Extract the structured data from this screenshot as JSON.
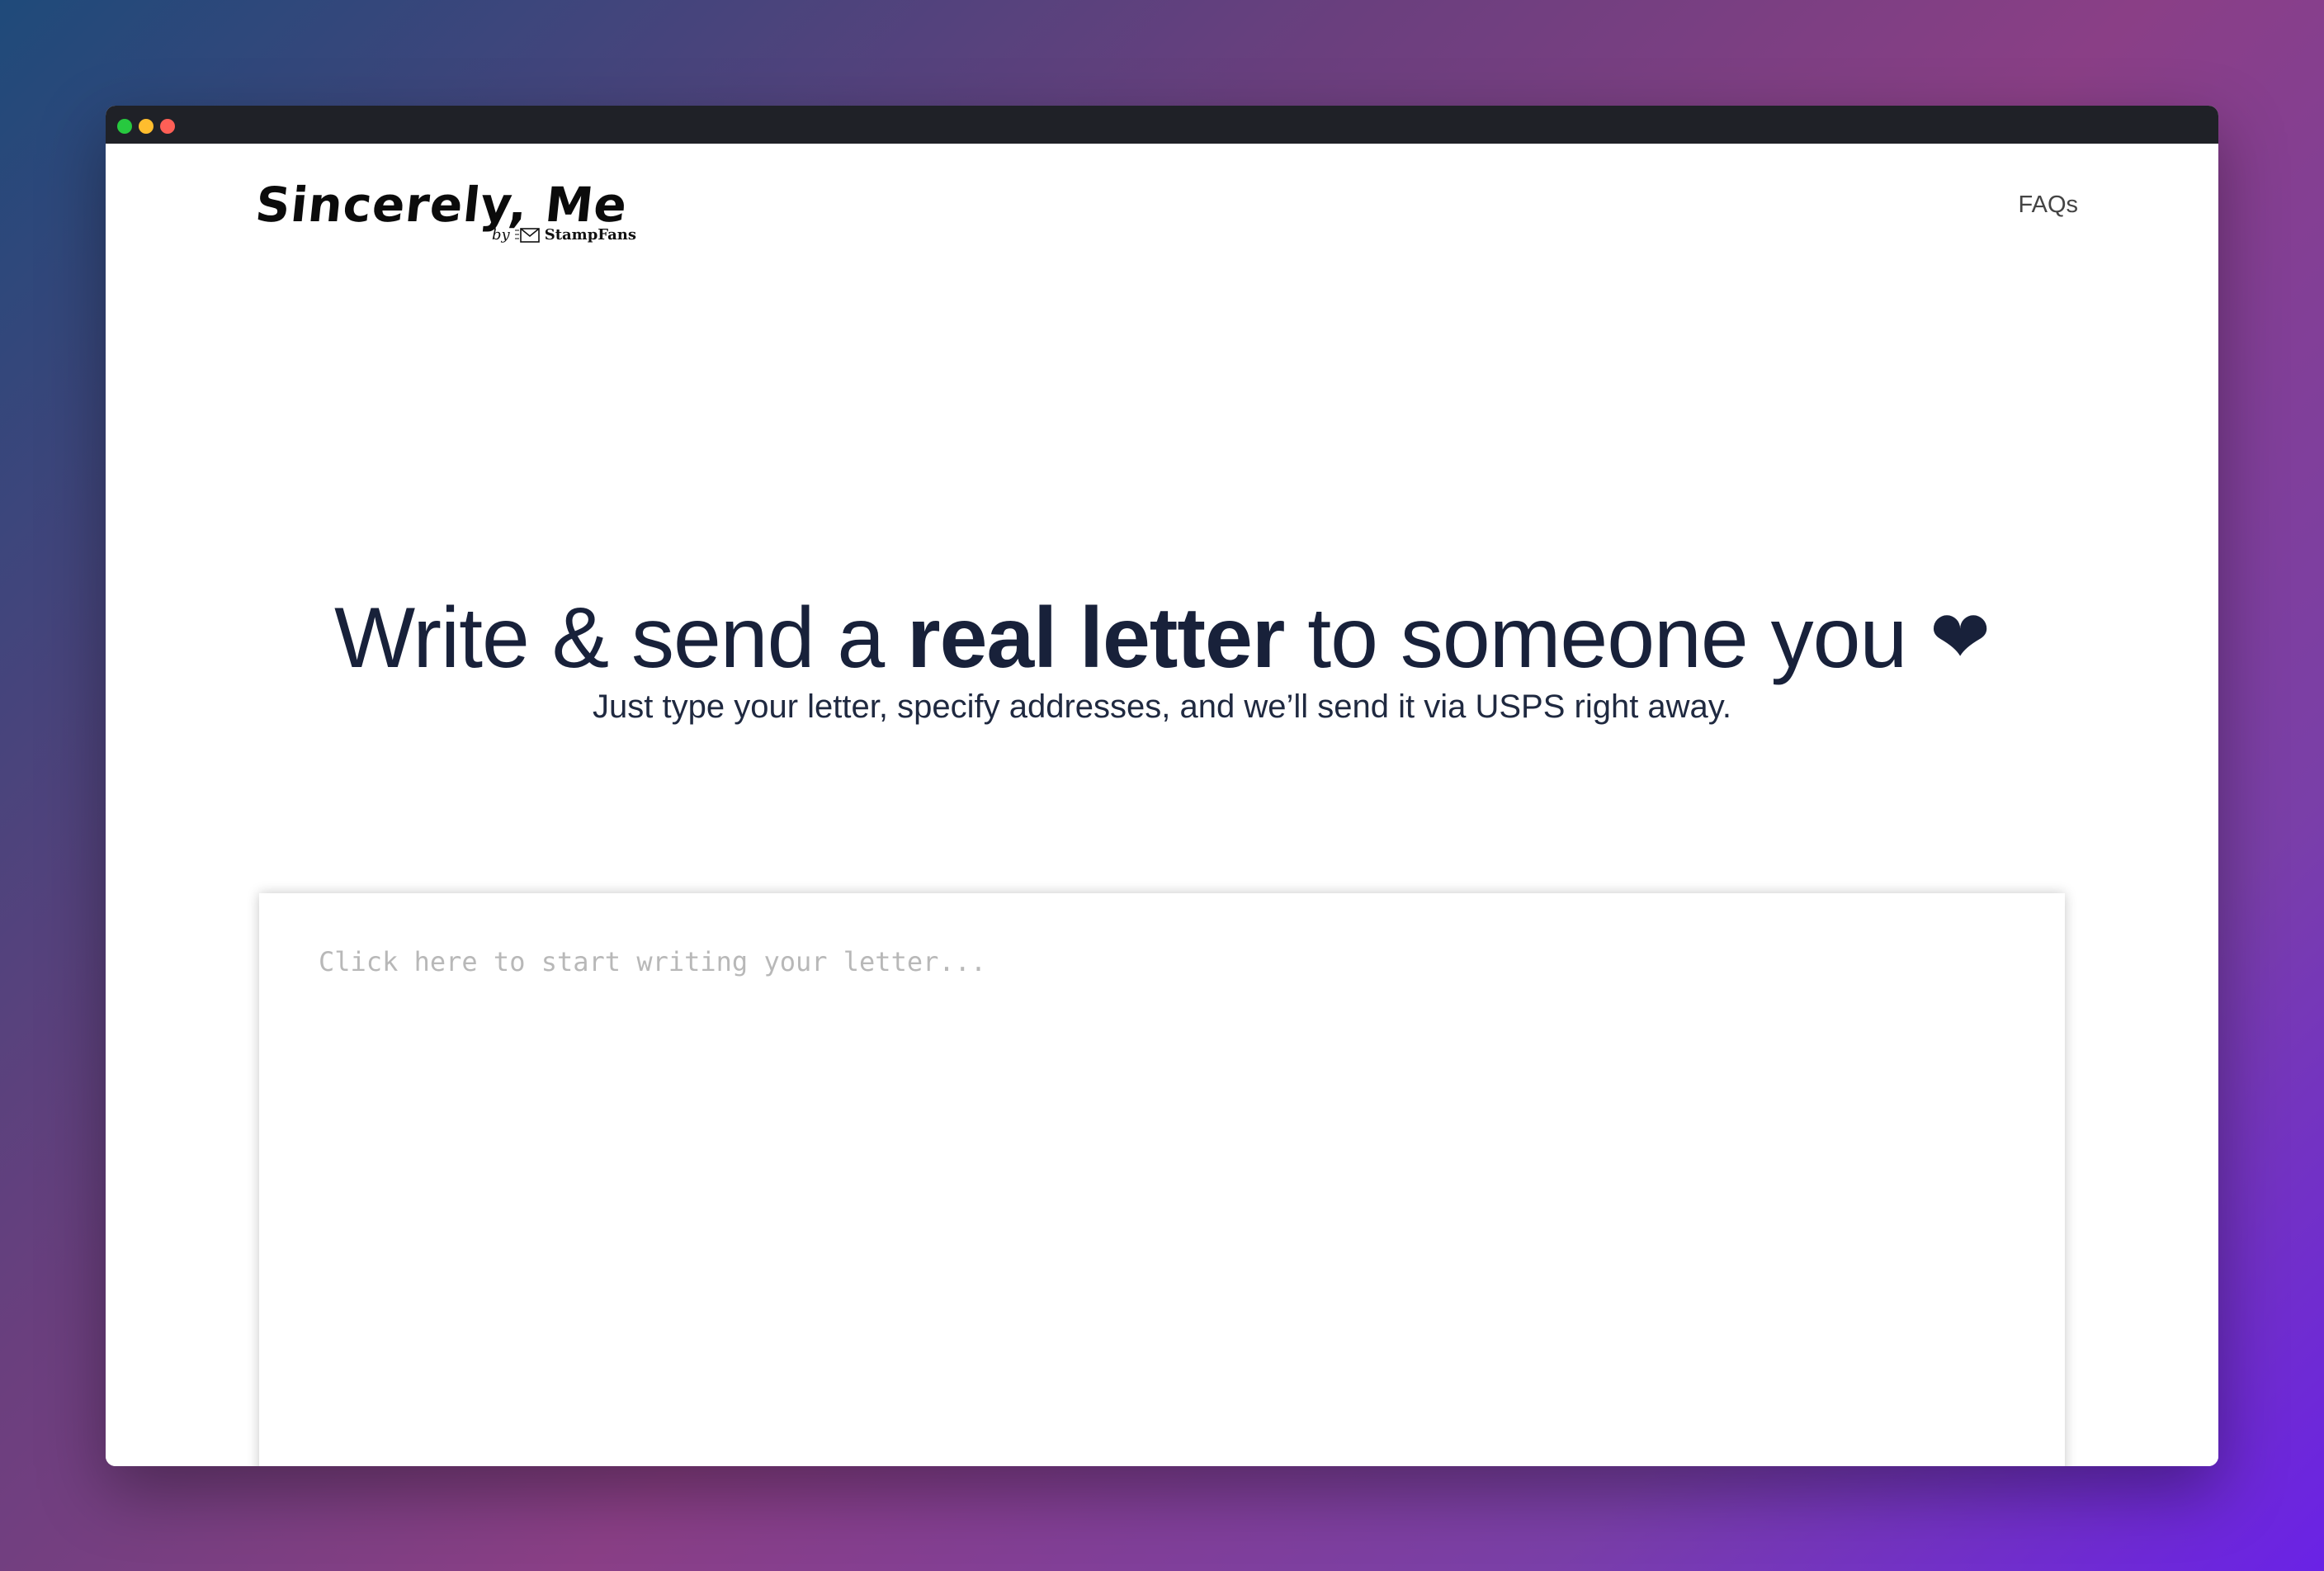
{
  "window": {
    "controls": {
      "green": "#27c93f",
      "yellow": "#ffbd2e",
      "red": "#ff5f56"
    }
  },
  "header": {
    "logo_title": "Sincerely, Me",
    "logo_by": "by",
    "logo_brand": "StampFans",
    "logo_icon": "envelope-icon",
    "nav_faqs": "FAQs"
  },
  "hero": {
    "title_pre": "Write & send a ",
    "title_bold": "real letter",
    "title_post": " to someone you ",
    "title_heart": "❤",
    "subtitle": "Just type your letter, specify addresses, and we’ll send it via USPS right away."
  },
  "editor": {
    "placeholder": "Click here to start writing your letter...",
    "value": ""
  },
  "colors": {
    "text_dark": "#18213a",
    "titlebar": "#1f2127"
  }
}
